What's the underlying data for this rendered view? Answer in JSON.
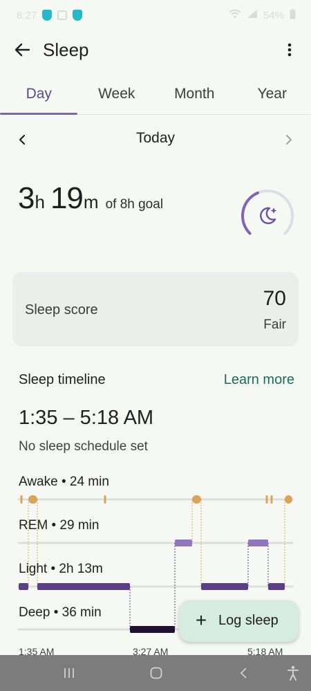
{
  "status_bar": {
    "time": "8:27",
    "battery": "54%"
  },
  "app_bar": {
    "title": "Sleep",
    "back_icon": "arrow-back-icon",
    "more_icon": "more-vert-icon"
  },
  "tabs": [
    {
      "label": "Day",
      "active": true
    },
    {
      "label": "Week",
      "active": false
    },
    {
      "label": "Month",
      "active": false
    },
    {
      "label": "Year",
      "active": false
    }
  ],
  "date_nav": {
    "label": "Today",
    "prev_icon": "chevron-left-icon",
    "next_icon": "chevron-right-icon"
  },
  "summary": {
    "hours": "3",
    "hours_unit": "h",
    "minutes": "19",
    "minutes_unit": "m",
    "goal_text": "of 8h goal",
    "goal_progress": 0.415,
    "ring_icon": "moon-stars-icon"
  },
  "sleep_score": {
    "label": "Sleep score",
    "value": "70",
    "rating": "Fair"
  },
  "timeline": {
    "title": "Sleep timeline",
    "learn_more": "Learn more",
    "time_range": "1:35 – 5:18 AM",
    "schedule": "No sleep schedule set",
    "stages": [
      {
        "key": "awake",
        "label": "Awake • 24 min"
      },
      {
        "key": "rem",
        "label": "REM • 29 min"
      },
      {
        "key": "light",
        "label": "Light • 2h 13m"
      },
      {
        "key": "deep",
        "label": "Deep • 36 min"
      }
    ],
    "axis_labels": [
      "1:35 AM",
      "3:27 AM",
      "5:18 AM"
    ]
  },
  "fab": {
    "label": "Log sleep",
    "icon": "plus-icon"
  },
  "colors": {
    "accent": "#7d66b6",
    "awake": "#d9a45a",
    "rem": "#8f76bd",
    "light": "#5a3f86",
    "deep": "#1f1033",
    "link": "#1a6b5b"
  }
}
